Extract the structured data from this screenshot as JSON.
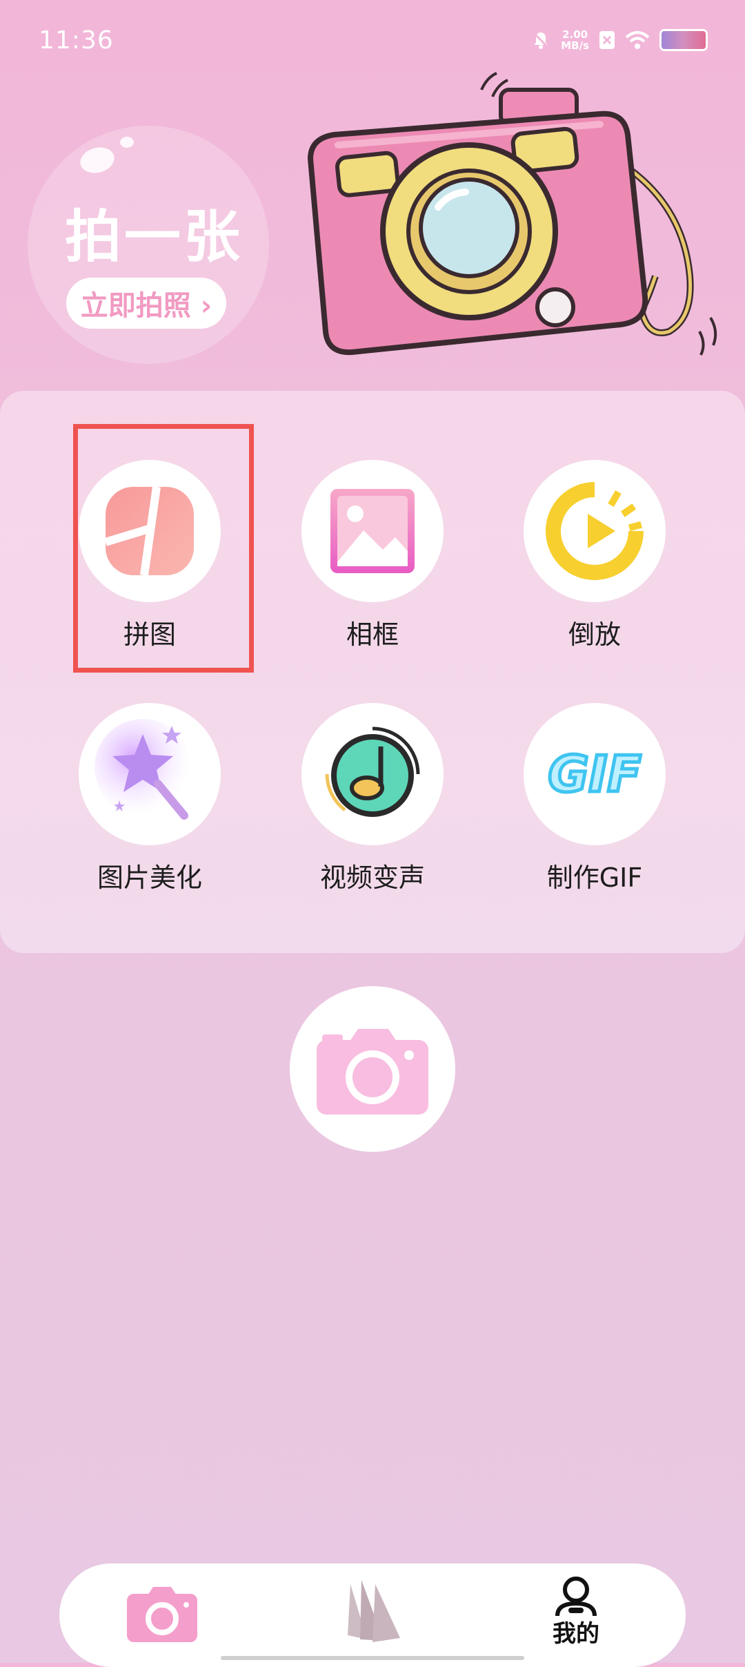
{
  "status_bar": {
    "time": "11:36",
    "net_speed_value": "2.00",
    "net_speed_unit": "MB/s"
  },
  "hero": {
    "title": "拍一张",
    "button_label": "立即拍照 ›"
  },
  "features": [
    {
      "label": "拼图",
      "icon": "collage-icon"
    },
    {
      "label": "相框",
      "icon": "frame-icon"
    },
    {
      "label": "倒放",
      "icon": "reverse-play-icon"
    },
    {
      "label": "图片美化",
      "icon": "magic-wand-icon"
    },
    {
      "label": "视频变声",
      "icon": "music-note-icon"
    },
    {
      "label": "制作GIF",
      "icon": "gif-icon"
    }
  ],
  "bottom_nav": {
    "items": [
      {
        "id": "camera",
        "icon": "camera-icon",
        "label": ""
      },
      {
        "id": "gallery",
        "icon": "album-icon",
        "label": ""
      },
      {
        "id": "mine",
        "icon": "user-icon",
        "label": "我的"
      }
    ]
  },
  "colors": {
    "accent_pink": "#f19ac2",
    "highlight": "#ef5350"
  }
}
